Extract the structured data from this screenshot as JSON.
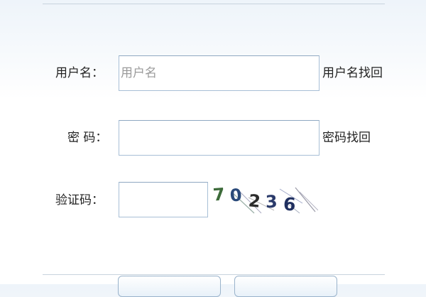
{
  "form": {
    "username_label": "用户名：",
    "username_placeholder": "用户名",
    "username_value": "",
    "username_recover_link": "用户名找回",
    "password_label": "密 码：",
    "password_value": "",
    "password_recover_link": "密码找回",
    "captcha_label": "验证码：",
    "captcha_value": "",
    "captcha_image_text": "70236"
  },
  "colors": {
    "captcha_digit_1": "#3d6b3a",
    "captcha_digit_2": "#2a4a7a",
    "captcha_digit_3": "#2b2b2b",
    "captcha_digit_4": "#2a3a6a",
    "captcha_digit_5": "#1f2f5f",
    "input_border": "#a8bfd6"
  }
}
